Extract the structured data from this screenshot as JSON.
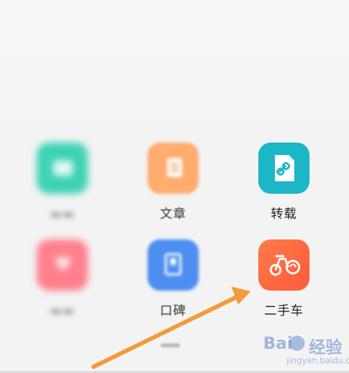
{
  "apps": [
    {
      "id": "a1",
      "label": "",
      "color": "#3ed2b4",
      "icon": "square-icon",
      "state": "blurred"
    },
    {
      "id": "article",
      "label": "文章",
      "color": "#ffac6f",
      "icon": "document-icon",
      "state": "soft"
    },
    {
      "id": "repost",
      "label": "转载",
      "color": "#1bb7c6",
      "icon": "link-document-icon",
      "state": "sharp"
    },
    {
      "id": "a4",
      "label": "",
      "color": "#ff7f8d",
      "icon": "heart-icon",
      "state": "blurred"
    },
    {
      "id": "reputation",
      "label": "口碑",
      "color": "#4d8ff0",
      "icon": "bookmark-icon",
      "state": "soft"
    },
    {
      "id": "used_car",
      "label": "二手车",
      "color": "#ff6a44",
      "icon": "motorbike-icon",
      "state": "sharp"
    }
  ],
  "annotation": {
    "color": "#f39a3a",
    "icon": "arrow-icon"
  },
  "watermark": {
    "text": "Bai",
    "text2": "经验",
    "sub": "jingyan.baidu.com"
  }
}
